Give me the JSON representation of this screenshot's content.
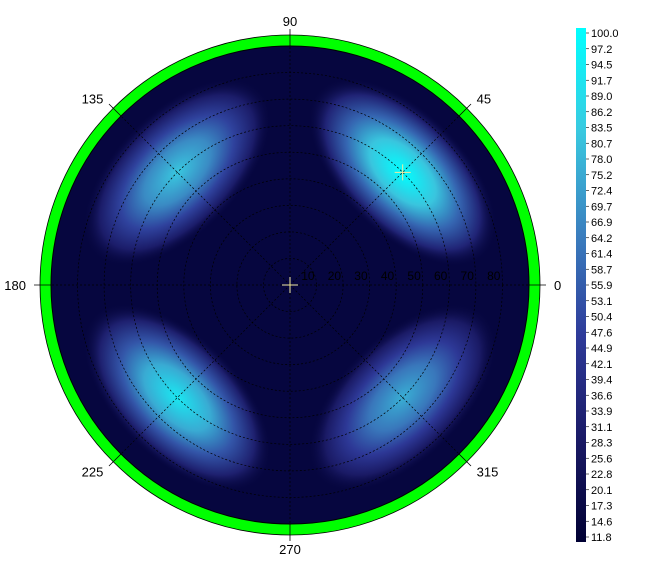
{
  "chart_data": {
    "type": "heatmap",
    "projection": "polar",
    "title": "",
    "angle_labels": [
      "0",
      "45",
      "90",
      "135",
      "180",
      "225",
      "270",
      "315"
    ],
    "angle_label_degrees": [
      0,
      45,
      90,
      135,
      180,
      225,
      270,
      315
    ],
    "radial_tick_labels": [
      "10",
      "20",
      "30",
      "40",
      "50",
      "60",
      "70",
      "80"
    ],
    "radial_ticks": [
      10,
      20,
      30,
      40,
      50,
      60,
      70,
      80
    ],
    "radial_range": [
      0,
      90
    ],
    "colorbar_labels": [
      "100.0",
      "97.2",
      "94.5",
      "91.7",
      "89.0",
      "86.2",
      "83.5",
      "80.7",
      "78.0",
      "75.2",
      "72.4",
      "69.7",
      "66.9",
      "64.2",
      "61.4",
      "58.7",
      "55.9",
      "53.1",
      "50.4",
      "47.6",
      "44.9",
      "42.1",
      "39.4",
      "36.6",
      "33.9",
      "31.1",
      "28.3",
      "25.6",
      "22.8",
      "20.1",
      "17.3",
      "14.6",
      "11.8"
    ],
    "color_range": [
      11.8,
      100.0
    ],
    "colormap": [
      "#000033",
      "#1a1a66",
      "#2e3a99",
      "#3a7fbf",
      "#39c9e0",
      "#00ffff"
    ],
    "outer_ring_color": "#00ff00",
    "grid": true,
    "markers": [
      {
        "label": "center",
        "azimuth_deg": 0,
        "elevation_deg": 0
      },
      {
        "label": "maximum",
        "azimuth_deg": 45,
        "elevation_deg": 60
      }
    ],
    "hotspots": [
      {
        "azimuth_deg": 45,
        "radius": 60,
        "value": 100.0
      },
      {
        "azimuth_deg": 135,
        "radius": 60,
        "value": 82.0
      },
      {
        "azimuth_deg": 225,
        "radius": 60,
        "value": 92.0
      },
      {
        "azimuth_deg": 315,
        "radius": 60,
        "value": 76.0
      }
    ],
    "baseline_value": 16.0
  }
}
